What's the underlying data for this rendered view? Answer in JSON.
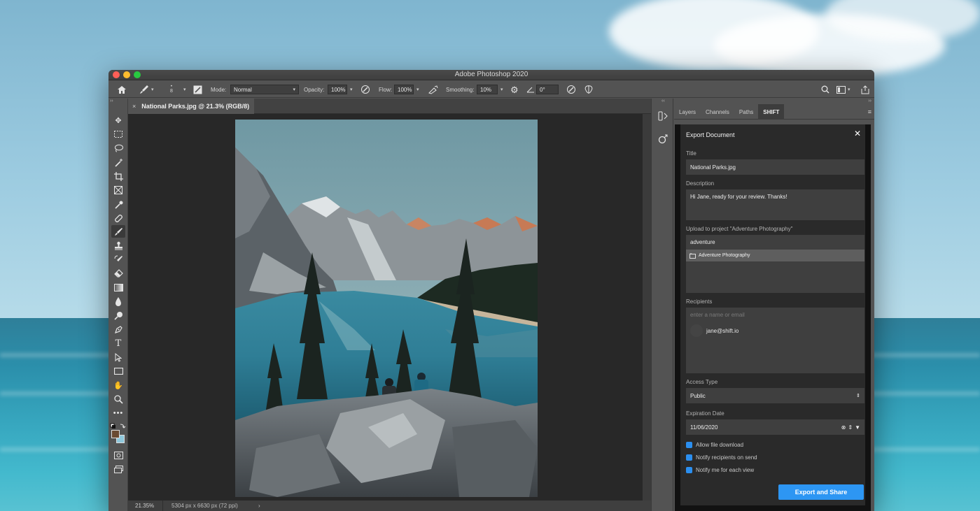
{
  "window": {
    "title": "Adobe Photoshop 2020"
  },
  "options_bar": {
    "brush_size": "8",
    "mode_label": "Mode:",
    "mode_value": "Normal",
    "opacity_label": "Opacity:",
    "opacity_value": "100%",
    "flow_label": "Flow:",
    "flow_value": "100%",
    "smoothing_label": "Smoothing:",
    "smoothing_value": "10%",
    "angle_value": "0°"
  },
  "document": {
    "tab_title": "National Parks.jpg @ 21.3% (RGB/8)",
    "zoom": "21.35%",
    "dimensions": "5304 px x 6630 px (72 ppi)"
  },
  "panel": {
    "tabs": [
      "Layers",
      "Channels",
      "Paths",
      "SHIFT"
    ],
    "active_tab": "SHIFT"
  },
  "export_dialog": {
    "heading": "Export Document",
    "title_label": "Title",
    "title_value": "National Parks.jpg",
    "description_label": "Description",
    "description_value": "Hi Jane, ready for your review. Thanks!",
    "project_label": "Upload to project \"Adventure Photography\"",
    "project_search": "adventure",
    "project_result": "Adventure Photography",
    "recipients_label": "Recipients",
    "recipients_placeholder": "enter a name or email",
    "recipient": "jane@shift.io",
    "access_label": "Access Type",
    "access_value": "Public",
    "expiration_label": "Expiration Date",
    "expiration_value": "11/06/2020",
    "checkboxes": [
      "Allow file download",
      "Notify recipients on send",
      "Notify me for each view"
    ],
    "export_button": "Export and Share"
  },
  "colors": {
    "accent": "#2d96f3",
    "checkbox": "#2b8ff0"
  }
}
